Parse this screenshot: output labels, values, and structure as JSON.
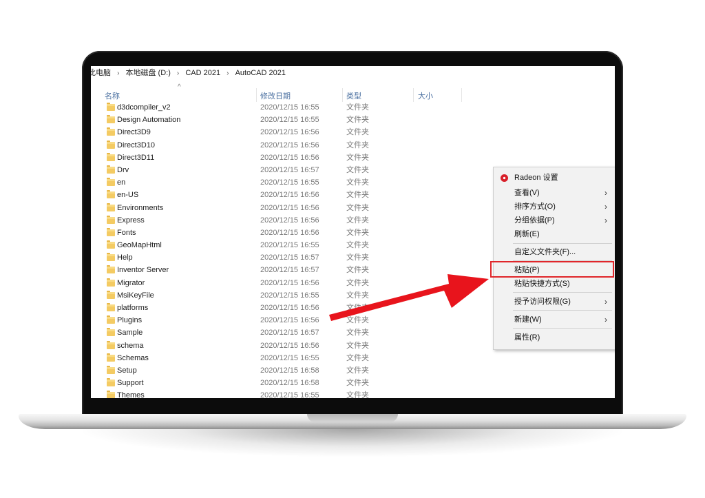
{
  "breadcrumb": [
    "此电脑",
    "本地磁盘 (D:)",
    "CAD 2021",
    "AutoCAD 2021"
  ],
  "columns": {
    "name": "名称",
    "date": "修改日期",
    "type": "类型",
    "size": "大小"
  },
  "rows": [
    {
      "name": "d3dcompiler_v2",
      "date": "2020/12/15 16:55",
      "type": "文件夹"
    },
    {
      "name": "Design Automation",
      "date": "2020/12/15 16:55",
      "type": "文件夹"
    },
    {
      "name": "Direct3D9",
      "date": "2020/12/15 16:56",
      "type": "文件夹"
    },
    {
      "name": "Direct3D10",
      "date": "2020/12/15 16:56",
      "type": "文件夹"
    },
    {
      "name": "Direct3D11",
      "date": "2020/12/15 16:56",
      "type": "文件夹"
    },
    {
      "name": "Drv",
      "date": "2020/12/15 16:57",
      "type": "文件夹"
    },
    {
      "name": "en",
      "date": "2020/12/15 16:55",
      "type": "文件夹"
    },
    {
      "name": "en-US",
      "date": "2020/12/15 16:56",
      "type": "文件夹"
    },
    {
      "name": "Environments",
      "date": "2020/12/15 16:56",
      "type": "文件夹"
    },
    {
      "name": "Express",
      "date": "2020/12/15 16:56",
      "type": "文件夹"
    },
    {
      "name": "Fonts",
      "date": "2020/12/15 16:56",
      "type": "文件夹"
    },
    {
      "name": "GeoMapHtml",
      "date": "2020/12/15 16:55",
      "type": "文件夹"
    },
    {
      "name": "Help",
      "date": "2020/12/15 16:57",
      "type": "文件夹"
    },
    {
      "name": "Inventor Server",
      "date": "2020/12/15 16:57",
      "type": "文件夹"
    },
    {
      "name": "Migrator",
      "date": "2020/12/15 16:56",
      "type": "文件夹"
    },
    {
      "name": "MsiKeyFile",
      "date": "2020/12/15 16:55",
      "type": "文件夹"
    },
    {
      "name": "platforms",
      "date": "2020/12/15 16:56",
      "type": "文件夹"
    },
    {
      "name": "Plugins",
      "date": "2020/12/15 16:56",
      "type": "文件夹"
    },
    {
      "name": "Sample",
      "date": "2020/12/15 16:57",
      "type": "文件夹"
    },
    {
      "name": "schema",
      "date": "2020/12/15 16:56",
      "type": "文件夹"
    },
    {
      "name": "Schemas",
      "date": "2020/12/15 16:55",
      "type": "文件夹"
    },
    {
      "name": "Setup",
      "date": "2020/12/15 16:58",
      "type": "文件夹"
    },
    {
      "name": "Support",
      "date": "2020/12/15 16:58",
      "type": "文件夹"
    },
    {
      "name": "Themes",
      "date": "2020/12/15 16:55",
      "type": "文件夹"
    }
  ],
  "context_menu": {
    "radeon": "Radeon 设置",
    "view": "查看(V)",
    "sort": "排序方式(O)",
    "group": "分组依据(P)",
    "refresh": "刷新(E)",
    "customize": "自定义文件夹(F)...",
    "paste": "粘贴(P)",
    "paste_shortcut": "粘贴快捷方式(S)",
    "grant_access": "授予访问权限(G)",
    "new": "新建(W)",
    "properties": "属性(R)"
  },
  "colors": {
    "highlight": "#e0262a",
    "arrow": "#e8141c",
    "folder": "#f4cb63"
  }
}
